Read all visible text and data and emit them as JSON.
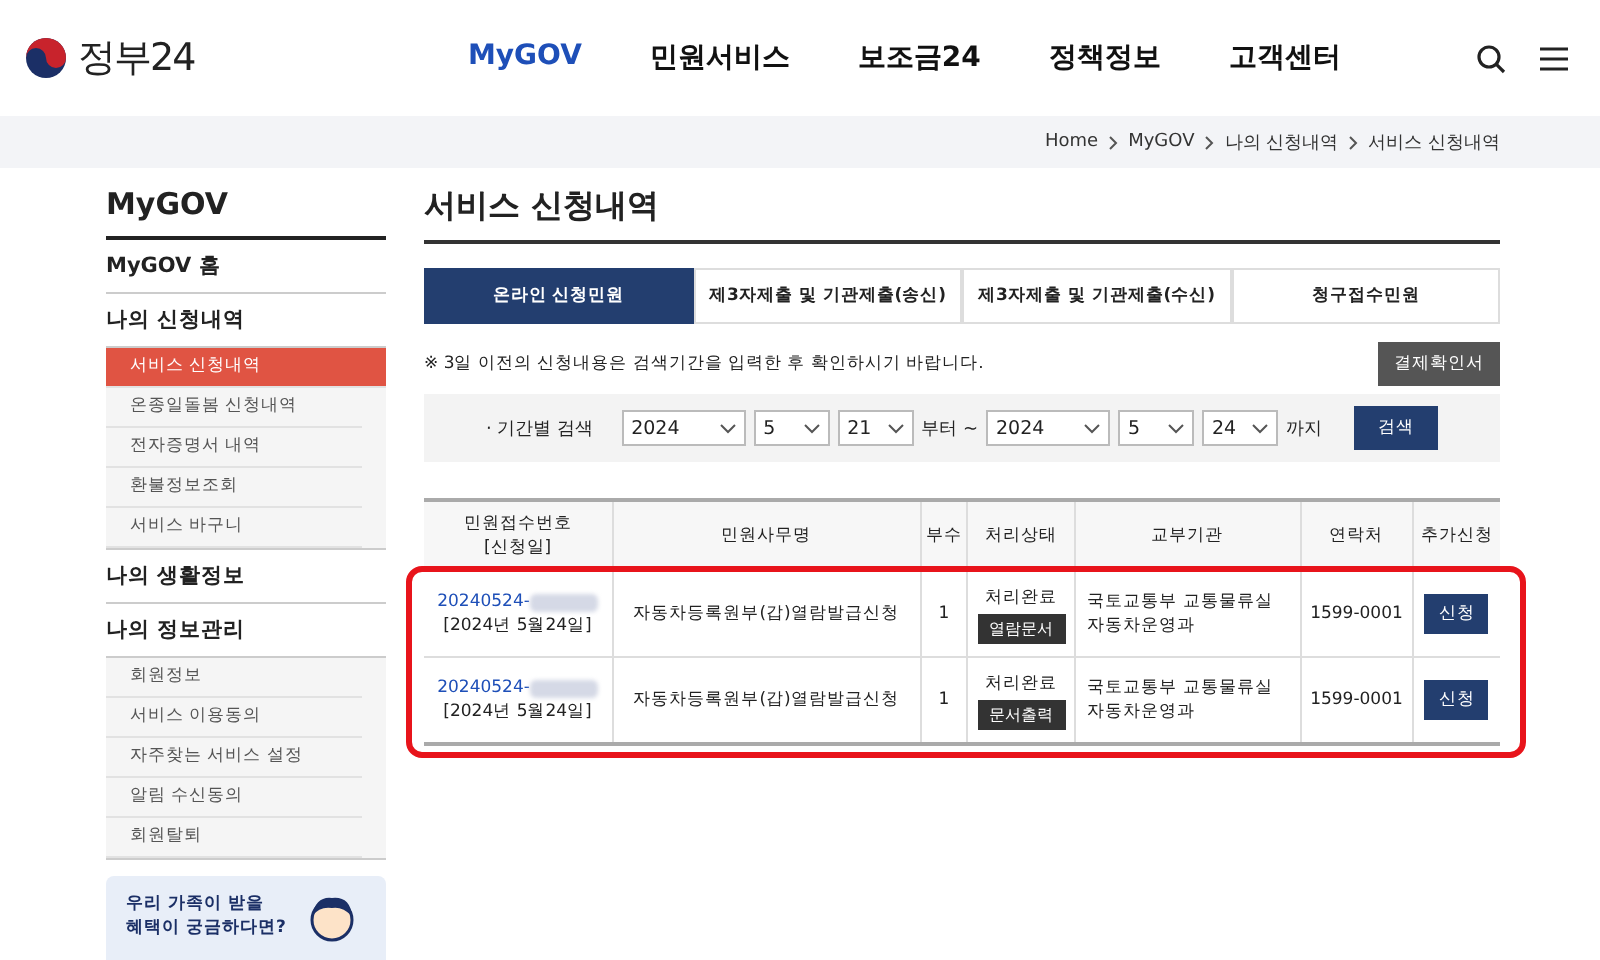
{
  "header": {
    "logo_text": "정부24",
    "nav": [
      {
        "label": "MyGOV",
        "selected": true
      },
      {
        "label": "민원서비스",
        "selected": false
      },
      {
        "label": "보조금24",
        "selected": false
      },
      {
        "label": "정책정보",
        "selected": false
      },
      {
        "label": "고객센터",
        "selected": false
      }
    ]
  },
  "breadcrumb": [
    "Home",
    "MyGOV",
    "나의 신청내역",
    "서비스 신청내역"
  ],
  "sidebar": {
    "title": "MyGOV",
    "sections": [
      {
        "label": "MyGOV 홈"
      },
      {
        "label": "나의 신청내역",
        "children": [
          {
            "label": "서비스 신청내역",
            "selected": true
          },
          {
            "label": "온종일돌봄 신청내역",
            "selected": false
          },
          {
            "label": "전자증명서 내역",
            "selected": false
          },
          {
            "label": "환불정보조회",
            "selected": false
          },
          {
            "label": "서비스 바구니",
            "selected": false
          }
        ]
      },
      {
        "label": "나의 생활정보"
      },
      {
        "label": "나의 정보관리",
        "children": [
          {
            "label": "회원정보",
            "selected": false
          },
          {
            "label": "서비스 이용동의",
            "selected": false
          },
          {
            "label": "자주찾는 서비스 설정",
            "selected": false
          },
          {
            "label": "알림 수신동의",
            "selected": false
          },
          {
            "label": "회원탈퇴",
            "selected": false
          }
        ]
      }
    ],
    "banner": [
      "우리 가족이 받을",
      "혜택이 궁금하다면?"
    ]
  },
  "page_title": "서비스 신청내역",
  "tabs": [
    {
      "label": "온라인 신청민원",
      "selected": true
    },
    {
      "label": "제3자제출 및 기관제출(송신)",
      "selected": false
    },
    {
      "label": "제3자제출 및 기관제출(수신)",
      "selected": false
    },
    {
      "label": "청구접수민원",
      "selected": false
    }
  ],
  "notice": "※ 3일 이전의 신청내용은 검색기간을 입력한 후 확인하시기 바랍니다.",
  "receipt_button": "결제확인서",
  "search": {
    "label": "· 기간별 검색",
    "from": [
      "2024",
      "5",
      "21"
    ],
    "from_suffix": "부터 ~",
    "to": [
      "2024",
      "5",
      "24"
    ],
    "to_suffix": "까지",
    "button": "검색"
  },
  "table": {
    "highlighted": true,
    "columns": [
      [
        "민원접수번호",
        "[신청일]"
      ],
      [
        "민원사무명"
      ],
      [
        "부수"
      ],
      [
        "처리상태"
      ],
      [
        "교부기관"
      ],
      [
        "연락처"
      ],
      [
        "추가신청"
      ]
    ],
    "rows": [
      {
        "number": "20240524-",
        "redacted": true,
        "date": "[2024년 5월24일]",
        "name": "자동차등록원부(갑)열람발급신청",
        "copies": "1",
        "status": "처리완료",
        "doc_button": "열람문서",
        "agency": "국토교통부 교통물류실 자동차운영과",
        "phone": "1599-0001",
        "apply_button": "신청"
      },
      {
        "number": "20240524-",
        "redacted": true,
        "date": "[2024년 5월24일]",
        "name": "자동차등록원부(갑)열람발급신청",
        "copies": "1",
        "status": "처리완료",
        "doc_button": "문서출력",
        "agency": "국토교통부 교통물류실 자동차운영과",
        "phone": "1599-0001",
        "apply_button": "신청"
      }
    ]
  }
}
